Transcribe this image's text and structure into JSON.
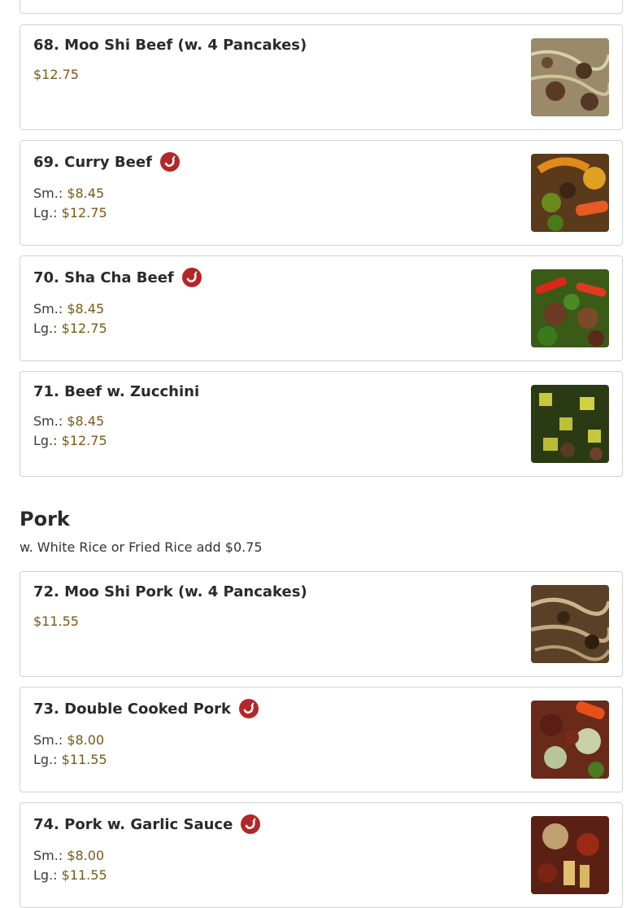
{
  "items": [
    {
      "name": "68. Moo Shi Beef (w. 4 Pancakes)",
      "spicy": false,
      "prices": [
        {
          "label": "",
          "value": "$12.75"
        }
      ]
    },
    {
      "name": "69. Curry Beef",
      "spicy": true,
      "prices": [
        {
          "label": "Sm.: ",
          "value": "$8.45"
        },
        {
          "label": "Lg.: ",
          "value": "$12.75"
        }
      ]
    },
    {
      "name": "70. Sha Cha Beef",
      "spicy": true,
      "prices": [
        {
          "label": "Sm.: ",
          "value": "$8.45"
        },
        {
          "label": "Lg.: ",
          "value": "$12.75"
        }
      ]
    },
    {
      "name": "71. Beef w. Zucchini",
      "spicy": false,
      "prices": [
        {
          "label": "Sm.: ",
          "value": "$8.45"
        },
        {
          "label": "Lg.: ",
          "value": "$12.75"
        }
      ]
    }
  ],
  "pork_section": {
    "title": "Pork",
    "subtitle": "w. White Rice or Fried Rice add $0.75",
    "items": [
      {
        "name": "72. Moo Shi Pork (w. 4 Pancakes)",
        "spicy": false,
        "prices": [
          {
            "label": "",
            "value": "$11.55"
          }
        ]
      },
      {
        "name": "73. Double Cooked Pork",
        "spicy": true,
        "prices": [
          {
            "label": "Sm.: ",
            "value": "$8.00"
          },
          {
            "label": "Lg.: ",
            "value": "$11.55"
          }
        ]
      },
      {
        "name": "74. Pork w. Garlic Sauce",
        "spicy": true,
        "prices": [
          {
            "label": "Sm.: ",
            "value": "$8.00"
          },
          {
            "label": "Lg.: ",
            "value": "$11.55"
          }
        ]
      }
    ]
  },
  "icons": {
    "spicy": "chili-pepper-icon"
  },
  "colors": {
    "price": "#7a5a14",
    "spicy_badge": "#b3262a",
    "border": "#d2d2d2"
  }
}
